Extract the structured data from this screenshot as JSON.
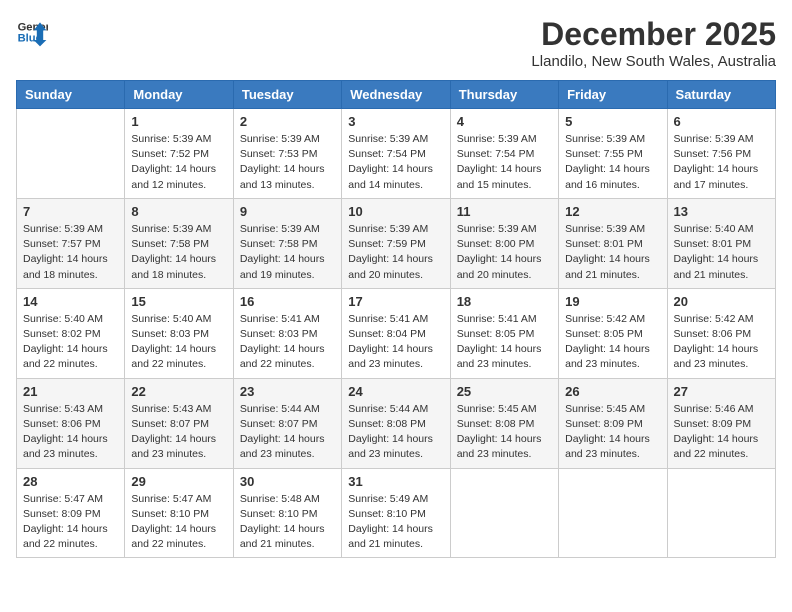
{
  "logo": {
    "line1": "General",
    "line2": "Blue"
  },
  "title": "December 2025",
  "location": "Llandilo, New South Wales, Australia",
  "days_of_week": [
    "Sunday",
    "Monday",
    "Tuesday",
    "Wednesday",
    "Thursday",
    "Friday",
    "Saturday"
  ],
  "weeks": [
    [
      {
        "day": "",
        "info": ""
      },
      {
        "day": "1",
        "info": "Sunrise: 5:39 AM\nSunset: 7:52 PM\nDaylight: 14 hours\nand 12 minutes."
      },
      {
        "day": "2",
        "info": "Sunrise: 5:39 AM\nSunset: 7:53 PM\nDaylight: 14 hours\nand 13 minutes."
      },
      {
        "day": "3",
        "info": "Sunrise: 5:39 AM\nSunset: 7:54 PM\nDaylight: 14 hours\nand 14 minutes."
      },
      {
        "day": "4",
        "info": "Sunrise: 5:39 AM\nSunset: 7:54 PM\nDaylight: 14 hours\nand 15 minutes."
      },
      {
        "day": "5",
        "info": "Sunrise: 5:39 AM\nSunset: 7:55 PM\nDaylight: 14 hours\nand 16 minutes."
      },
      {
        "day": "6",
        "info": "Sunrise: 5:39 AM\nSunset: 7:56 PM\nDaylight: 14 hours\nand 17 minutes."
      }
    ],
    [
      {
        "day": "7",
        "info": "Sunrise: 5:39 AM\nSunset: 7:57 PM\nDaylight: 14 hours\nand 18 minutes."
      },
      {
        "day": "8",
        "info": "Sunrise: 5:39 AM\nSunset: 7:58 PM\nDaylight: 14 hours\nand 18 minutes."
      },
      {
        "day": "9",
        "info": "Sunrise: 5:39 AM\nSunset: 7:58 PM\nDaylight: 14 hours\nand 19 minutes."
      },
      {
        "day": "10",
        "info": "Sunrise: 5:39 AM\nSunset: 7:59 PM\nDaylight: 14 hours\nand 20 minutes."
      },
      {
        "day": "11",
        "info": "Sunrise: 5:39 AM\nSunset: 8:00 PM\nDaylight: 14 hours\nand 20 minutes."
      },
      {
        "day": "12",
        "info": "Sunrise: 5:39 AM\nSunset: 8:01 PM\nDaylight: 14 hours\nand 21 minutes."
      },
      {
        "day": "13",
        "info": "Sunrise: 5:40 AM\nSunset: 8:01 PM\nDaylight: 14 hours\nand 21 minutes."
      }
    ],
    [
      {
        "day": "14",
        "info": "Sunrise: 5:40 AM\nSunset: 8:02 PM\nDaylight: 14 hours\nand 22 minutes."
      },
      {
        "day": "15",
        "info": "Sunrise: 5:40 AM\nSunset: 8:03 PM\nDaylight: 14 hours\nand 22 minutes."
      },
      {
        "day": "16",
        "info": "Sunrise: 5:41 AM\nSunset: 8:03 PM\nDaylight: 14 hours\nand 22 minutes."
      },
      {
        "day": "17",
        "info": "Sunrise: 5:41 AM\nSunset: 8:04 PM\nDaylight: 14 hours\nand 23 minutes."
      },
      {
        "day": "18",
        "info": "Sunrise: 5:41 AM\nSunset: 8:05 PM\nDaylight: 14 hours\nand 23 minutes."
      },
      {
        "day": "19",
        "info": "Sunrise: 5:42 AM\nSunset: 8:05 PM\nDaylight: 14 hours\nand 23 minutes."
      },
      {
        "day": "20",
        "info": "Sunrise: 5:42 AM\nSunset: 8:06 PM\nDaylight: 14 hours\nand 23 minutes."
      }
    ],
    [
      {
        "day": "21",
        "info": "Sunrise: 5:43 AM\nSunset: 8:06 PM\nDaylight: 14 hours\nand 23 minutes."
      },
      {
        "day": "22",
        "info": "Sunrise: 5:43 AM\nSunset: 8:07 PM\nDaylight: 14 hours\nand 23 minutes."
      },
      {
        "day": "23",
        "info": "Sunrise: 5:44 AM\nSunset: 8:07 PM\nDaylight: 14 hours\nand 23 minutes."
      },
      {
        "day": "24",
        "info": "Sunrise: 5:44 AM\nSunset: 8:08 PM\nDaylight: 14 hours\nand 23 minutes."
      },
      {
        "day": "25",
        "info": "Sunrise: 5:45 AM\nSunset: 8:08 PM\nDaylight: 14 hours\nand 23 minutes."
      },
      {
        "day": "26",
        "info": "Sunrise: 5:45 AM\nSunset: 8:09 PM\nDaylight: 14 hours\nand 23 minutes."
      },
      {
        "day": "27",
        "info": "Sunrise: 5:46 AM\nSunset: 8:09 PM\nDaylight: 14 hours\nand 22 minutes."
      }
    ],
    [
      {
        "day": "28",
        "info": "Sunrise: 5:47 AM\nSunset: 8:09 PM\nDaylight: 14 hours\nand 22 minutes."
      },
      {
        "day": "29",
        "info": "Sunrise: 5:47 AM\nSunset: 8:10 PM\nDaylight: 14 hours\nand 22 minutes."
      },
      {
        "day": "30",
        "info": "Sunrise: 5:48 AM\nSunset: 8:10 PM\nDaylight: 14 hours\nand 21 minutes."
      },
      {
        "day": "31",
        "info": "Sunrise: 5:49 AM\nSunset: 8:10 PM\nDaylight: 14 hours\nand 21 minutes."
      },
      {
        "day": "",
        "info": ""
      },
      {
        "day": "",
        "info": ""
      },
      {
        "day": "",
        "info": ""
      }
    ]
  ]
}
